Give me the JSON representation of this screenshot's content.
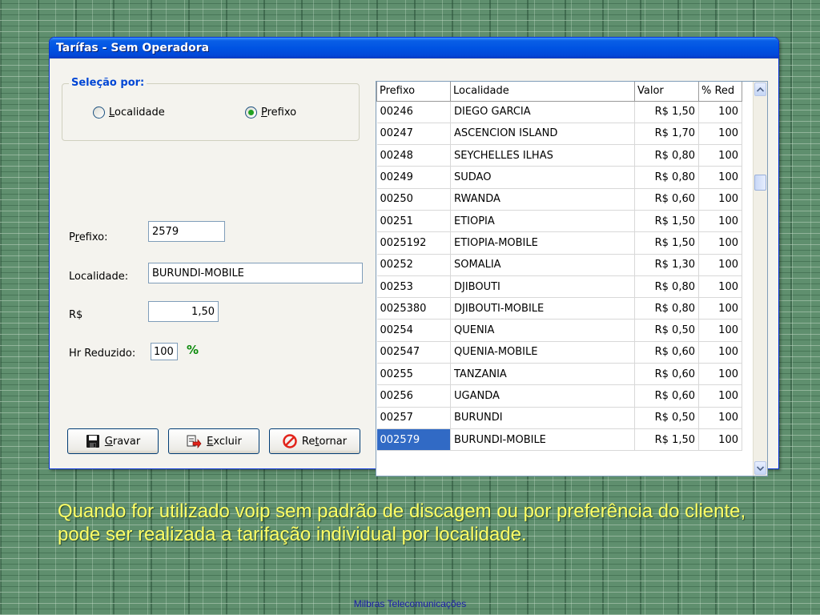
{
  "window": {
    "title": "Tarífas - Sem Operadora"
  },
  "selection": {
    "legend": "Seleção por:",
    "options": [
      {
        "label": "Localidade",
        "selected": false
      },
      {
        "label": "Prefixo",
        "selected": true
      }
    ]
  },
  "form": {
    "prefixo_label": "Prefixo:",
    "prefixo_value": "2579",
    "localidade_label": "Localidade:",
    "localidade_value": "BURUNDI-MOBILE",
    "valor_label": "R$",
    "valor_value": "1,50",
    "reduzido_label": "Hr Reduzido:",
    "reduzido_value": "100",
    "percent_symbol": "%"
  },
  "buttons": {
    "gravar": "Gravar",
    "excluir": "Excluir",
    "retornar": "Retornar"
  },
  "table": {
    "columns": [
      "Prefixo",
      "Localidade",
      "Valor",
      "% Red"
    ],
    "rows": [
      [
        "00246",
        "DIEGO GARCIA",
        "R$ 1,50",
        "100"
      ],
      [
        "00247",
        "ASCENCION ISLAND",
        "R$ 1,70",
        "100"
      ],
      [
        "00248",
        "SEYCHELLES ILHAS",
        "R$ 0,80",
        "100"
      ],
      [
        "00249",
        "SUDAO",
        "R$ 0,80",
        "100"
      ],
      [
        "00250",
        "RWANDA",
        "R$ 0,60",
        "100"
      ],
      [
        "00251",
        "ETIOPIA",
        "R$ 1,50",
        "100"
      ],
      [
        "0025192",
        "ETIOPIA-MOBILE",
        "R$ 1,50",
        "100"
      ],
      [
        "00252",
        "SOMALIA",
        "R$ 1,30",
        "100"
      ],
      [
        "00253",
        "DJIBOUTI",
        "R$ 0,80",
        "100"
      ],
      [
        "0025380",
        "DJIBOUTI-MOBILE",
        "R$ 0,80",
        "100"
      ],
      [
        "00254",
        "QUENIA",
        "R$ 0,50",
        "100"
      ],
      [
        "002547",
        "QUENIA-MOBILE",
        "R$ 0,60",
        "100"
      ],
      [
        "00255",
        "TANZANIA",
        "R$ 0,60",
        "100"
      ],
      [
        "00256",
        "UGANDA",
        "R$ 0,60",
        "100"
      ],
      [
        "00257",
        "BURUNDI",
        "R$ 0,50",
        "100"
      ],
      [
        "002579",
        "BURUNDI-MOBILE",
        "R$ 1,50",
        "100"
      ]
    ],
    "selected_row": 15
  },
  "caption": "Quando for utilizado voip sem padrão de discagem ou por preferência do cliente, pode ser realizada a tarifação individual por localidade.",
  "footer": "Milbras Telecomunicações",
  "colors": {
    "titlebar": "#0054e3",
    "selection": "#316ac5",
    "caption": "#ffff66",
    "legend": "#0046d5"
  }
}
